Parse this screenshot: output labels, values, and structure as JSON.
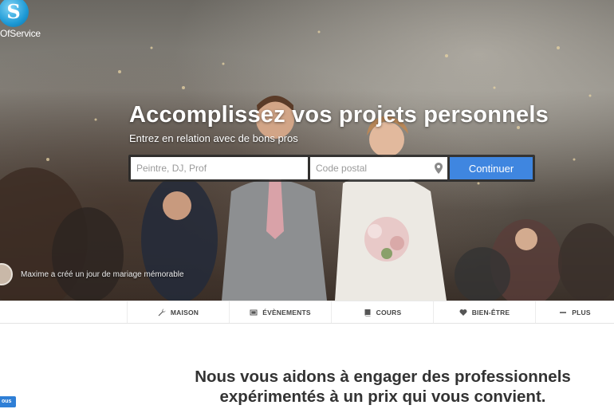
{
  "brand": {
    "logo_letter": "S",
    "name_visible": "OfService"
  },
  "hero": {
    "title": "Accomplissez vos projets personnels",
    "subtitle": "Entrez en relation avec de bons pros"
  },
  "search": {
    "job_placeholder": "Peintre, DJ, Prof",
    "postal_placeholder": "Code postal",
    "continue_label": "Continuer"
  },
  "testimonial": {
    "text": "Maxime a créé un jour de mariage mémorable"
  },
  "categories": [
    {
      "label": "MAISON",
      "icon": "wrench-icon"
    },
    {
      "label": "ÉVÈNEMENTS",
      "icon": "photo-icon"
    },
    {
      "label": "COURS",
      "icon": "book-icon"
    },
    {
      "label": "BIEN-ÊTRE",
      "icon": "heart-icon"
    },
    {
      "label": "PLUS",
      "icon": "minus-icon"
    }
  ],
  "main": {
    "heading_line1": "Nous vous aidons à engager des professionnels",
    "heading_line2": "expérimentés à un prix qui vous convient."
  },
  "floating_badge": {
    "text": "ous"
  },
  "colors": {
    "accent": "#3f86e0",
    "logo": "#1e9ad6",
    "heading": "#333333"
  }
}
